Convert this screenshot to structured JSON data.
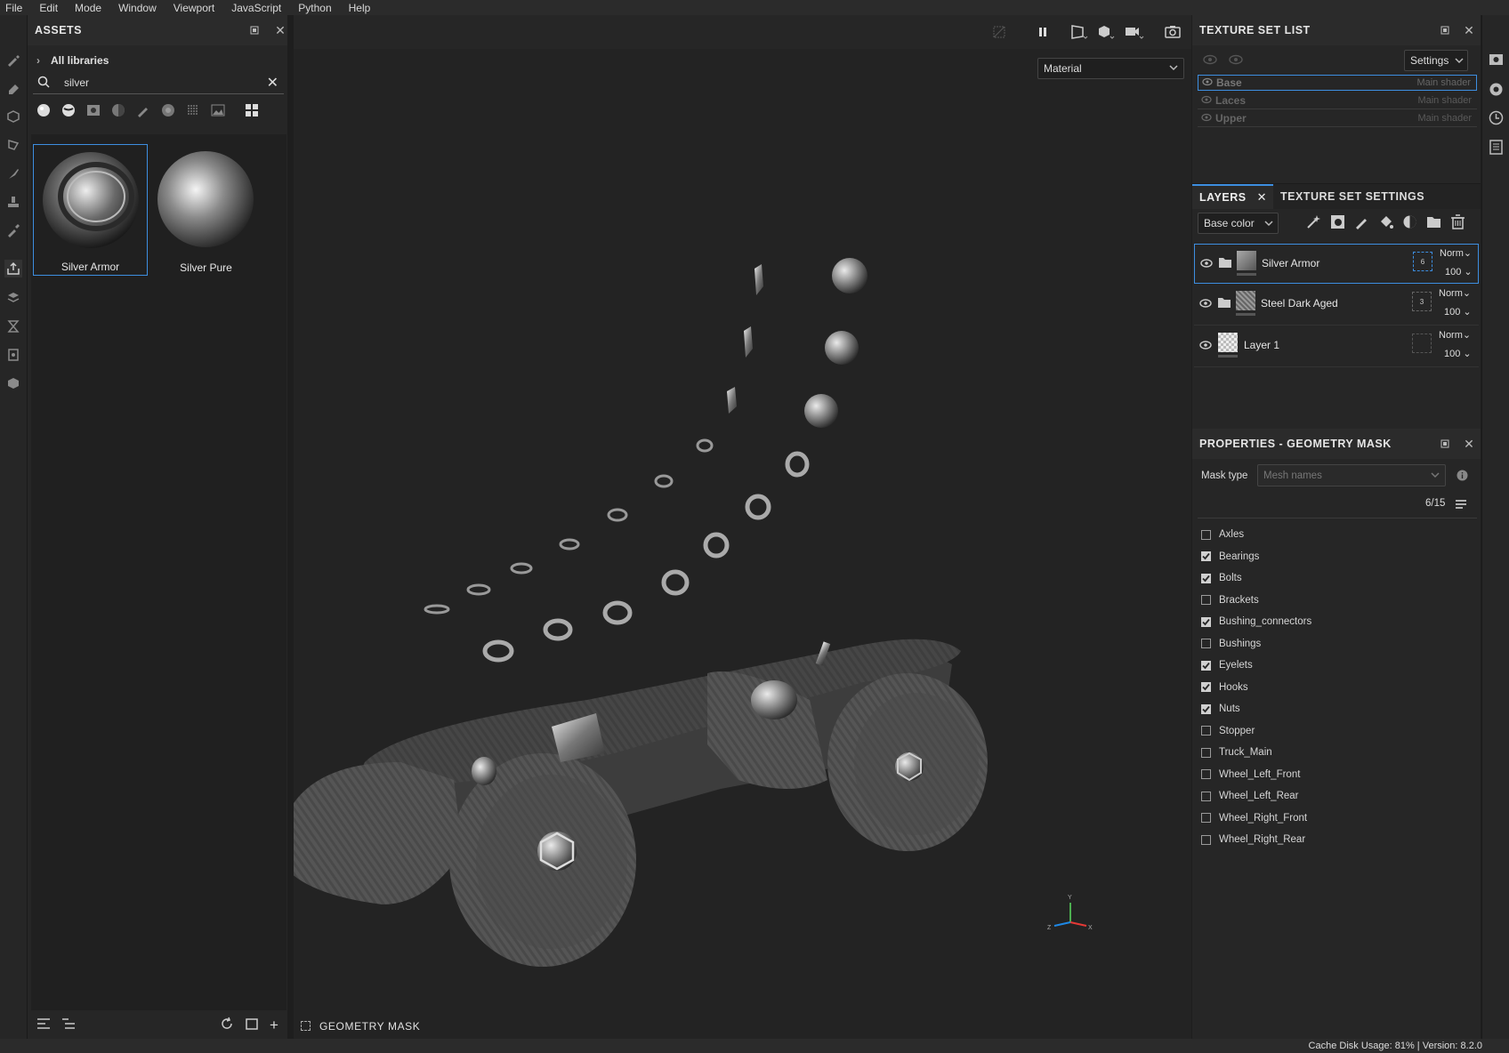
{
  "menubar": {
    "items": [
      "File",
      "Edit",
      "Mode",
      "Window",
      "Viewport",
      "JavaScript",
      "Python",
      "Help"
    ]
  },
  "assets": {
    "title": "ASSETS",
    "breadcrumb": "All libraries",
    "search_value": "silver",
    "items": [
      {
        "label": "Silver Armor",
        "selected": true
      },
      {
        "label": "Silver Pure",
        "selected": false
      }
    ]
  },
  "viewport": {
    "mode_dropdown": "Material",
    "footer_label": "GEOMETRY MASK"
  },
  "texture_set_list": {
    "title": "TEXTURE SET LIST",
    "settings_label": "Settings",
    "sets": [
      {
        "name": "Base",
        "shader": "Main shader",
        "selected": true
      },
      {
        "name": "Laces",
        "shader": "Main shader",
        "selected": false
      },
      {
        "name": "Upper",
        "shader": "Main shader",
        "selected": false
      }
    ]
  },
  "layers": {
    "tab_label": "LAYERS",
    "tab2_label": "TEXTURE SET SETTINGS",
    "channel": "Base color",
    "rows": [
      {
        "name": "Silver Armor",
        "blend": "Norm",
        "opacity": "100",
        "mask_count": "6",
        "selected": true
      },
      {
        "name": "Steel Dark Aged",
        "blend": "Norm",
        "opacity": "100",
        "mask_count": "3",
        "selected": false
      },
      {
        "name": "Layer 1",
        "blend": "Norm",
        "opacity": "100",
        "mask_count": "",
        "selected": false
      }
    ]
  },
  "properties": {
    "title": "PROPERTIES - GEOMETRY MASK",
    "mask_type_label": "Mask type",
    "mask_type_value": "Mesh names",
    "count": "6/15",
    "meshes": [
      {
        "name": "Axles",
        "checked": false
      },
      {
        "name": "Bearings",
        "checked": true
      },
      {
        "name": "Bolts",
        "checked": true
      },
      {
        "name": "Brackets",
        "checked": false
      },
      {
        "name": "Bushing_connectors",
        "checked": true
      },
      {
        "name": "Bushings",
        "checked": false
      },
      {
        "name": "Eyelets",
        "checked": true
      },
      {
        "name": "Hooks",
        "checked": true
      },
      {
        "name": "Nuts",
        "checked": true
      },
      {
        "name": "Stopper",
        "checked": false
      },
      {
        "name": "Truck_Main",
        "checked": false
      },
      {
        "name": "Wheel_Left_Front",
        "checked": false
      },
      {
        "name": "Wheel_Left_Rear",
        "checked": false
      },
      {
        "name": "Wheel_Right_Front",
        "checked": false
      },
      {
        "name": "Wheel_Right_Rear",
        "checked": false
      }
    ]
  },
  "status": {
    "text": "Cache Disk Usage:   81% | Version: 8.2.0"
  },
  "colors": {
    "accent": "#3d8ee0",
    "panel": "#262626",
    "viewport": "#232323"
  }
}
